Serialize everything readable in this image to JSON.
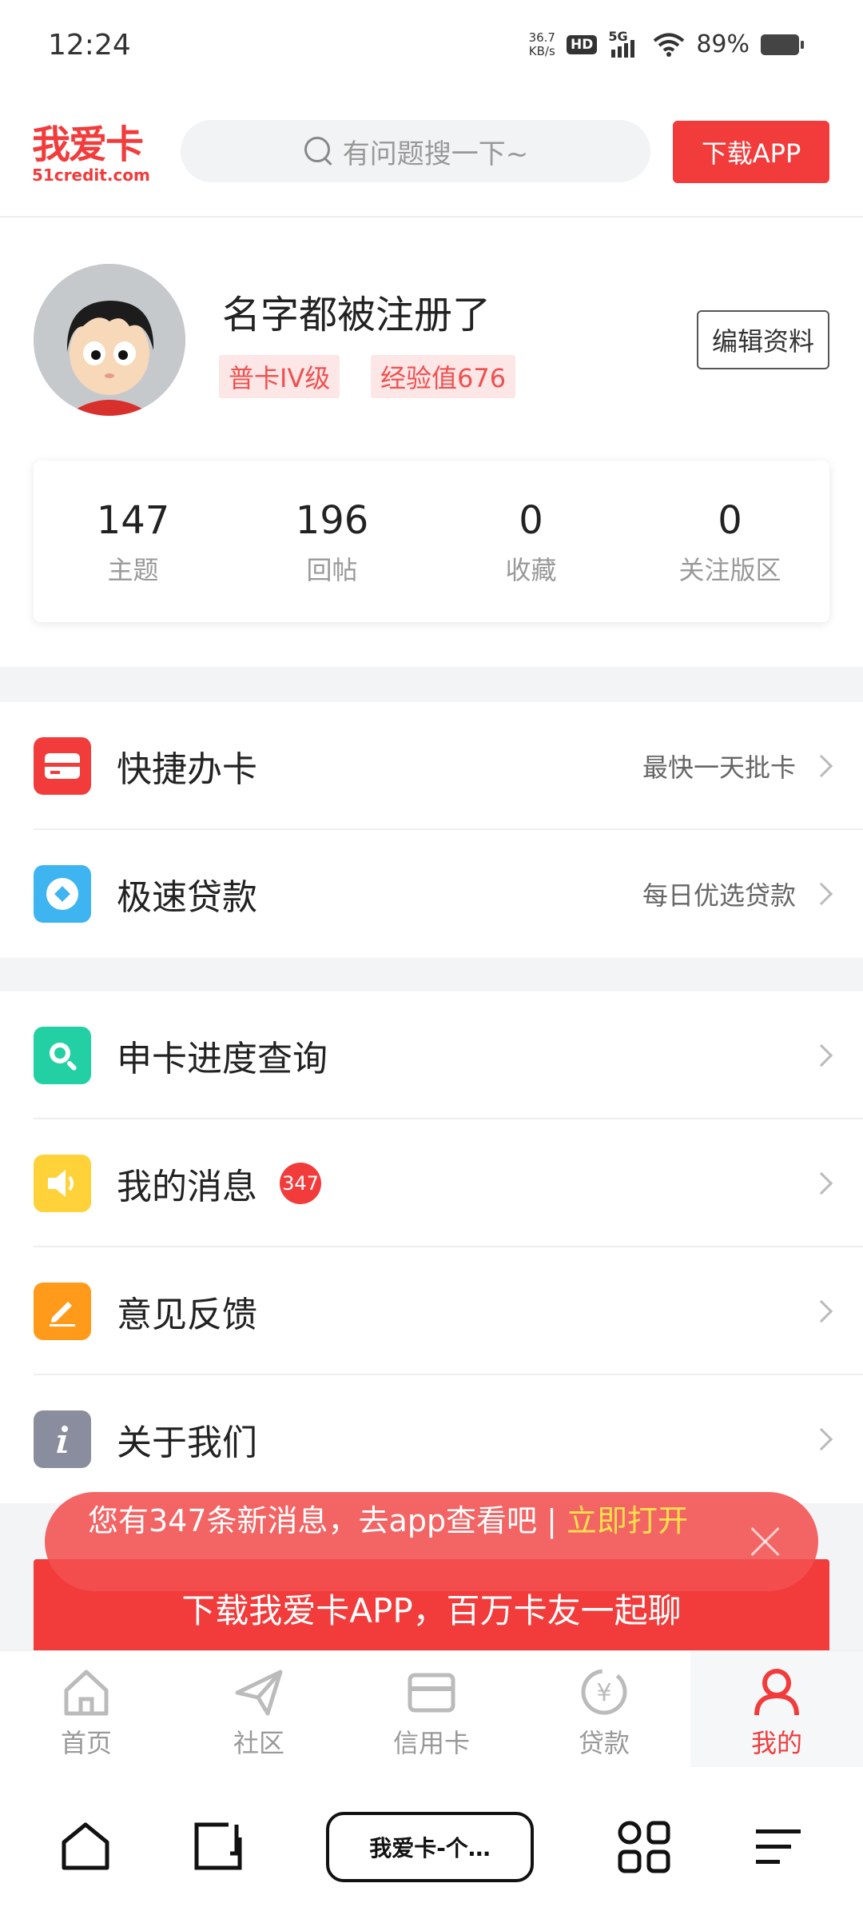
{
  "status_bar": {
    "time": "12:24",
    "net_speed_value": "36.7",
    "net_speed_unit": "KB/s",
    "hd": "HD",
    "network": "5G",
    "battery_percent": "89%"
  },
  "header": {
    "logo_text": "我爱卡",
    "logo_domain": "51credit.com",
    "search_placeholder": "有问题搜一下~",
    "download_label": "下载APP"
  },
  "profile": {
    "name": "名字都被注册了",
    "level_tag": "普卡IV级",
    "exp_tag": "经验值676",
    "edit_label": "编辑资料",
    "stats": [
      {
        "value": "147",
        "label": "主题"
      },
      {
        "value": "196",
        "label": "回帖"
      },
      {
        "value": "0",
        "label": "收藏"
      },
      {
        "value": "0",
        "label": "关注版区"
      }
    ]
  },
  "menu_primary": [
    {
      "label": "快捷办卡",
      "sub": "最快一天批卡",
      "icon": "card-icon",
      "color": "#f23c3c"
    },
    {
      "label": "极速贷款",
      "sub": "每日优选贷款",
      "icon": "loan-icon",
      "color": "#3eb4f0"
    }
  ],
  "menu_secondary": [
    {
      "label": "申卡进度查询",
      "icon": "search-progress-icon",
      "color": "#22d0a4"
    },
    {
      "label": "我的消息",
      "badge": "347",
      "icon": "speaker-icon",
      "color": "#ffd23a"
    },
    {
      "label": "意见反馈",
      "icon": "edit-icon",
      "color": "#ff9a1a"
    },
    {
      "label": "关于我们",
      "icon": "info-icon",
      "color": "#8a8d9e"
    }
  ],
  "message_banner": {
    "text": "您有347条新消息，去app查看吧 | ",
    "link": "立即打开"
  },
  "app_banner": {
    "text": "下载我爱卡APP，百万卡友一起聊"
  },
  "bottom_nav": [
    {
      "label": "首页",
      "icon": "home-icon"
    },
    {
      "label": "社区",
      "icon": "send-icon"
    },
    {
      "label": "信用卡",
      "icon": "credit-card-icon"
    },
    {
      "label": "贷款",
      "icon": "yen-icon"
    },
    {
      "label": "我的",
      "icon": "user-icon",
      "active": true
    }
  ],
  "system_nav": {
    "task_label": "我爱卡-个…"
  },
  "colors": {
    "brand_red": "#f23c3c",
    "tag_bg": "#fde6e6",
    "link_yellow": "#ffe14a"
  }
}
